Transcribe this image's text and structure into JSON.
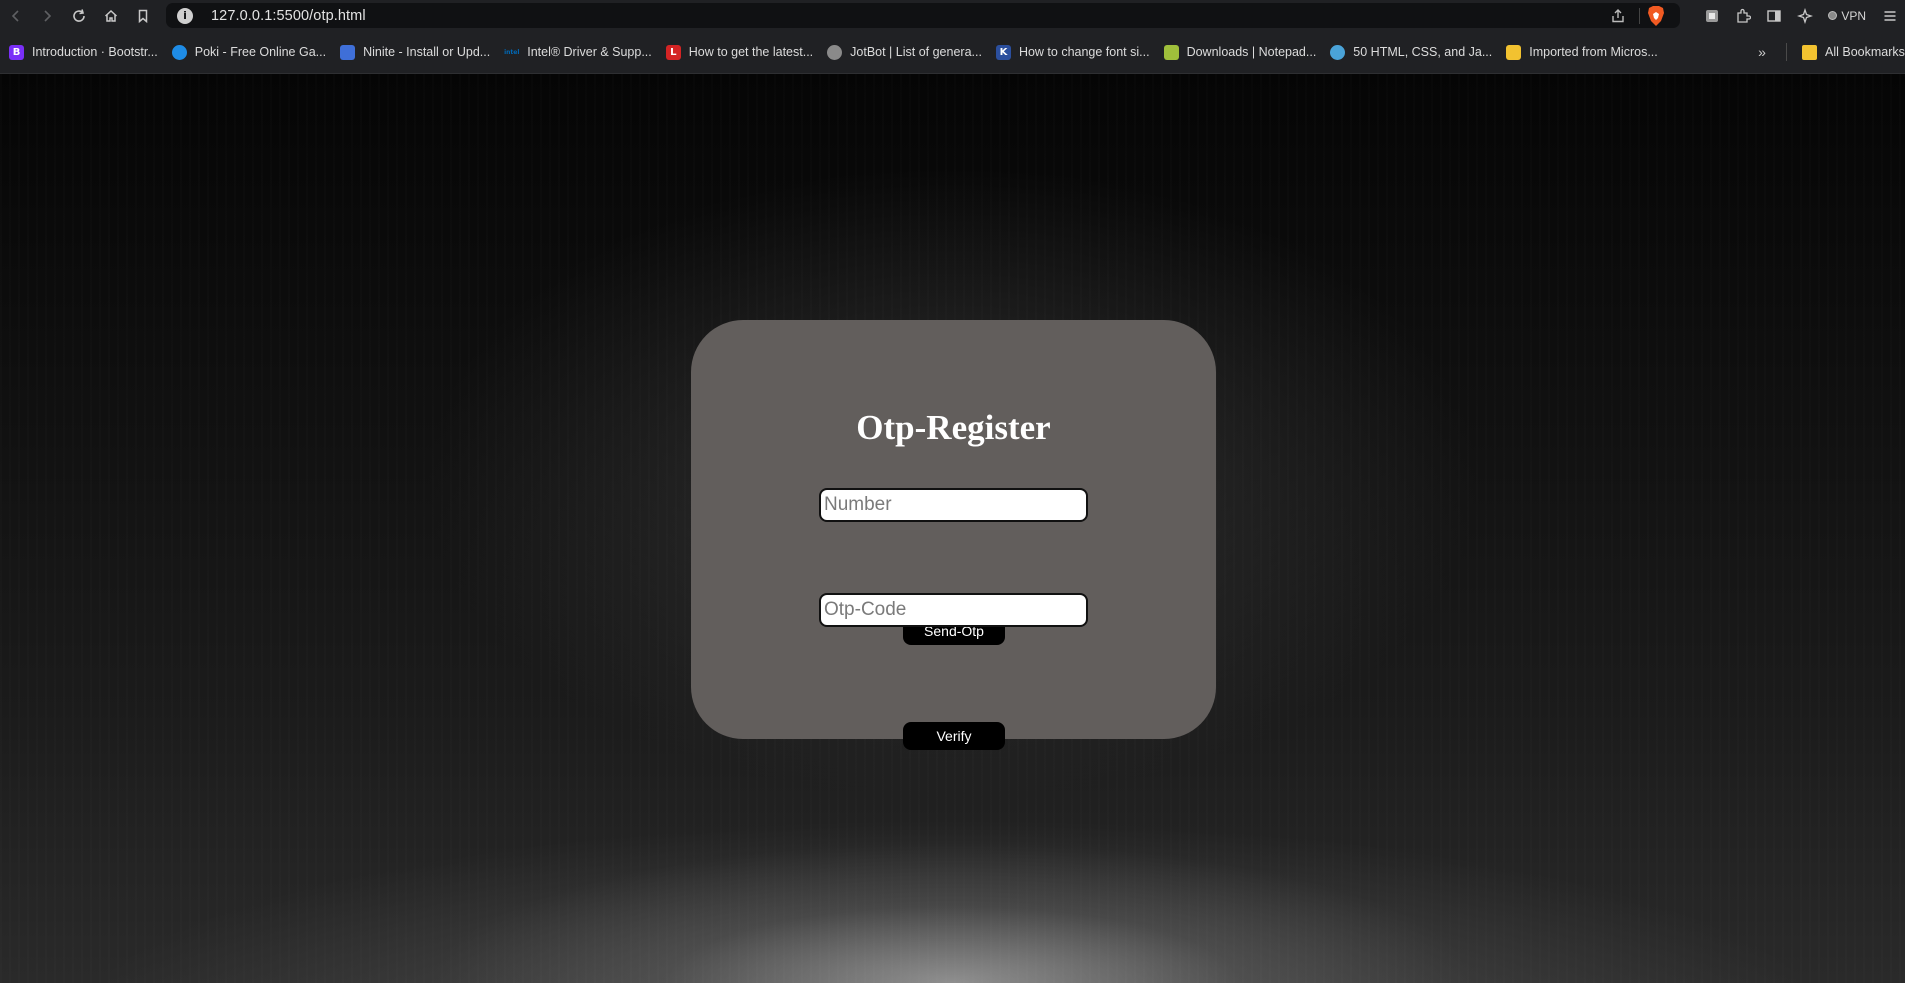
{
  "browser": {
    "url": "127.0.0.1:5500/otp.html",
    "vpn_label": "VPN",
    "bookmarks": [
      {
        "label": "Introduction · Bootstr...",
        "icon": "bootstrap-icon",
        "icon_char": "B",
        "color": "#7a2ff7"
      },
      {
        "label": "Poki - Free Online Ga...",
        "icon": "poki-icon",
        "icon_char": "",
        "color": "#1e8ce6"
      },
      {
        "label": "Ninite - Install or Upd...",
        "icon": "ninite-icon",
        "icon_char": "",
        "color": "#3f6fd8"
      },
      {
        "label": "Intel® Driver & Supp...",
        "icon": "intel-icon",
        "icon_char": "intel",
        "color": "#0068b5"
      },
      {
        "label": "How to get the latest...",
        "icon": "l-logo-icon",
        "icon_char": "L",
        "color": "#d42424"
      },
      {
        "label": "JotBot | List of genera...",
        "icon": "jotbot-icon",
        "icon_char": "",
        "color": "#8a8a8a"
      },
      {
        "label": "How to change font si...",
        "icon": "k-logo-icon",
        "icon_char": "K",
        "color": "#2b4f9e"
      },
      {
        "label": "Downloads | Notepad...",
        "icon": "notepad-icon",
        "icon_char": "",
        "color": "#9fbf3b"
      },
      {
        "label": "50 HTML, CSS, and Ja...",
        "icon": "globe-avatar-icon",
        "icon_char": "",
        "color": "#4aa3d8"
      },
      {
        "label": "Imported from Micros...",
        "icon": "folder-icon",
        "icon_char": "",
        "color": "#f2c230"
      }
    ],
    "all_bookmarks_label": "All Bookmarks"
  },
  "page": {
    "title": "Otp-Register",
    "number_placeholder": "Number",
    "send_otp_label": "Send-Otp",
    "otp_placeholder": "Otp-Code",
    "verify_label": "Verify"
  }
}
